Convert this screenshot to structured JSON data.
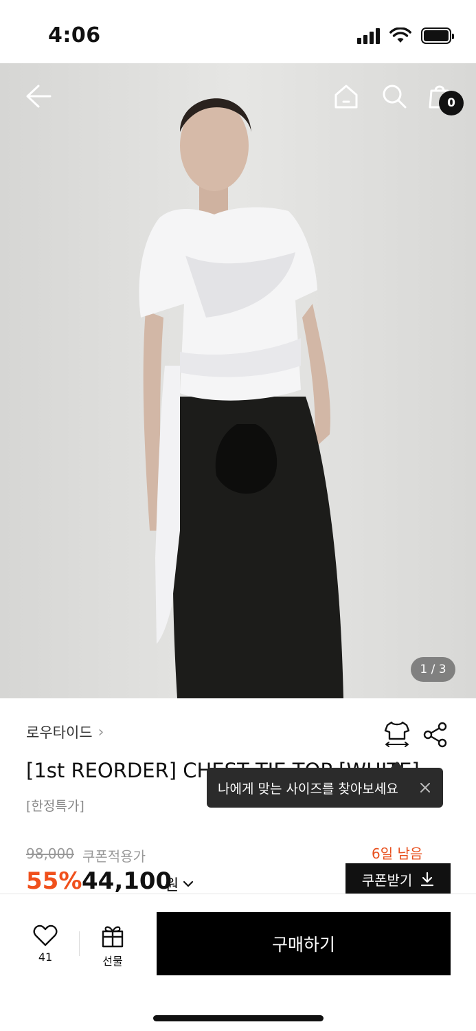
{
  "status_bar": {
    "time": "4:06"
  },
  "header": {
    "back_icon": "arrow-left-icon",
    "home_icon": "home-icon",
    "search_icon": "search-icon",
    "cart_icon": "shopping-bag-icon",
    "cart_count": "0"
  },
  "gallery": {
    "pager": "1 / 3"
  },
  "product": {
    "brand": "로우타이드",
    "brand_chevron": "›",
    "title": "[1st REORDER] CHEST TIE TOP [WHITE]",
    "tag": "[한정특가]",
    "original_price": "98,000",
    "coupon_label": "쿠폰적용가",
    "remaining": "6일 남음",
    "discount": "55%",
    "price": "44,100",
    "currency": "원",
    "coupon_button": "쿠폰받기"
  },
  "tooltip": {
    "text": "나에게 맞는 사이즈를 찾아보세요"
  },
  "bottom_bar": {
    "like_count": "41",
    "gift_label": "선물",
    "buy_label": "구매하기"
  },
  "colors": {
    "accent": "#f0501c",
    "remain": "#e8501e",
    "primary": "#000000"
  }
}
